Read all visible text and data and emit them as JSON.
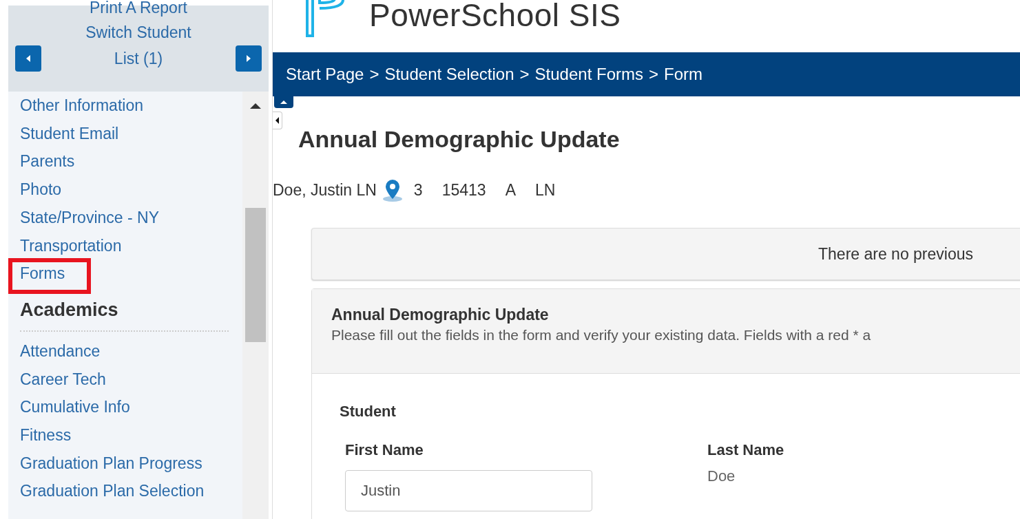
{
  "sidebar": {
    "header_links": [
      "Print A Report",
      "Switch Student",
      "List (1)"
    ],
    "items": [
      {
        "label": "Other Information",
        "highlighted": false
      },
      {
        "label": "Student Email",
        "highlighted": false
      },
      {
        "label": "Parents",
        "highlighted": false
      },
      {
        "label": "Photo",
        "highlighted": false
      },
      {
        "label": "State/Province - NY",
        "highlighted": false
      },
      {
        "label": "Transportation",
        "highlighted": false
      },
      {
        "label": "Forms",
        "highlighted": true
      }
    ],
    "section": {
      "title": "Academics",
      "items": [
        "Attendance",
        "Career Tech",
        "Cumulative Info",
        "Fitness",
        "Graduation Plan Progress",
        "Graduation Plan Selection"
      ]
    }
  },
  "header": {
    "product": "PowerSchool SIS"
  },
  "breadcrumb": {
    "separator": ">",
    "items": [
      "Start Page",
      "Student Selection",
      "Student Forms",
      "Form"
    ]
  },
  "page_title": "Annual Demographic Update",
  "student_line": {
    "name": "Doe, Justin LN",
    "fields": [
      "3",
      "15413",
      "A",
      "LN"
    ]
  },
  "notice": "There are no previous",
  "form": {
    "title": "Annual Demographic Update",
    "instructions": "Please fill out the fields in the form and verify your existing data. Fields with a red * a",
    "section": "Student",
    "fields": [
      {
        "label": "First Name",
        "kind": "input",
        "value": "Justin"
      },
      {
        "label": "Last Name",
        "kind": "static",
        "value": "Doe"
      }
    ]
  }
}
